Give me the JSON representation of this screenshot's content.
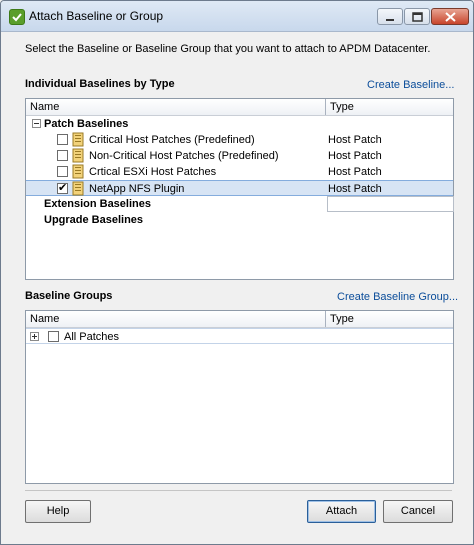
{
  "window": {
    "title": "Attach Baseline or Group"
  },
  "intro_text": "Select the Baseline or Baseline Group that you want to attach to APDM Datacenter.",
  "individual": {
    "title": "Individual Baselines by Type",
    "create_link": "Create Baseline...",
    "columns": {
      "name": "Name",
      "type": "Type"
    },
    "groups": [
      {
        "label": "Patch Baselines",
        "expander": "minus"
      },
      {
        "label": "Extension Baselines"
      },
      {
        "label": "Upgrade Baselines"
      }
    ],
    "items": [
      {
        "name": "Critical Host Patches (Predefined)",
        "type": "Host Patch",
        "checked": false
      },
      {
        "name": "Non-Critical Host Patches (Predefined)",
        "type": "Host Patch",
        "checked": false
      },
      {
        "name": "Crtical ESXi Host Patches",
        "type": "Host Patch",
        "checked": false
      },
      {
        "name": "NetApp NFS Plugin",
        "type": "Host Patch",
        "checked": true,
        "selected": true
      }
    ]
  },
  "groups_section": {
    "title": "Baseline Groups",
    "create_link": "Create Baseline Group...",
    "columns": {
      "name": "Name",
      "type": "Type"
    },
    "items": [
      {
        "name": "All Patches",
        "checked": false,
        "expander": "plus"
      }
    ]
  },
  "buttons": {
    "help": "Help",
    "attach": "Attach",
    "cancel": "Cancel"
  },
  "colors": {
    "link": "#0b4d9a",
    "selection": "#d7e4f4",
    "titlebar": "#c8d8ec"
  }
}
